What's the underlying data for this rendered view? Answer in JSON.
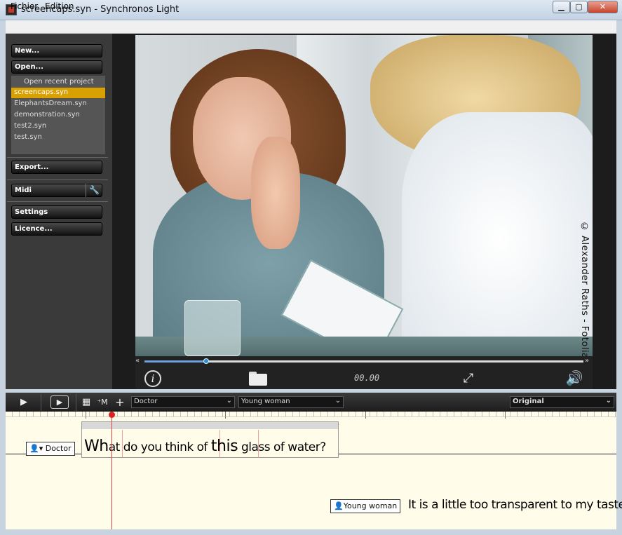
{
  "window": {
    "title": "screencaps.syn - Synchronos Light",
    "minimize": "▁",
    "maximize": "▢",
    "close": "✕"
  },
  "menu": {
    "items": [
      "Fichier",
      "Edition"
    ]
  },
  "sidebar": {
    "new_label": "New...",
    "open_label": "Open...",
    "recent_heading": "Open recent project",
    "recent": [
      "screencaps.syn",
      "ElephantsDream.syn",
      "demonstration.syn",
      "test2.syn",
      "test.syn"
    ],
    "selected_recent": "screencaps.syn",
    "export_label": "Export...",
    "midi_label": "Midi",
    "settings_label": "Settings",
    "licence_label": "Licence..."
  },
  "video": {
    "copyright": "© Alexander Raths - Fotolia.com",
    "timecode": "00.00",
    "progress_fraction": 0.14,
    "seek_start": "«",
    "seek_end": "»"
  },
  "toolbar": {
    "speaker1": "Doctor",
    "speaker2": "Young woman",
    "mode": "Original"
  },
  "timeline": {
    "speaker_doctor": "▾ Doctor",
    "speaker_woman": "Young woman",
    "lyric_parts": [
      "Wh",
      "at do you think of ",
      "this",
      " glass of water?"
    ],
    "answer": "It is a little too transparent to my taste"
  },
  "colors": {
    "selected_recent": "#d8a000",
    "playhead": "#e04040",
    "timeline_bg": "#fffdea"
  }
}
